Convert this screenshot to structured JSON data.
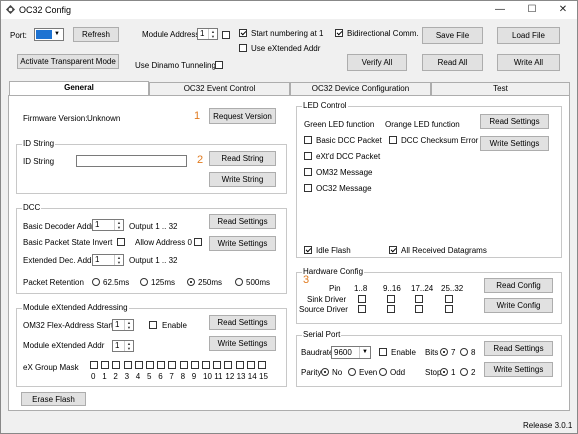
{
  "window": {
    "title": "OC32 Config",
    "minimize": "—",
    "maximize": "☐",
    "close": "✕"
  },
  "top": {
    "port_label": "Port:",
    "refresh": "Refresh",
    "module_address_label": "Module Address",
    "module_address_value": "1",
    "start_numbering": "Start numbering at 1",
    "use_extended": "Use eXtended Addr",
    "bidirectional": "Bidirectional Comm.",
    "save_file": "Save File",
    "load_file": "Load File",
    "activate_transparent": "Activate Transparent Mode",
    "use_dinamo": "Use Dinamo Tunneling",
    "verify_all": "Verify All",
    "read_all": "Read All",
    "write_all": "Write All"
  },
  "tabs": [
    "General",
    "OC32 Event Control",
    "OC32 Device Configuration",
    "Test"
  ],
  "general": {
    "firmware_label": "Firmware Version:",
    "firmware_value": "Unknown",
    "marker1": "1",
    "request_version": "Request Version",
    "id_group": "ID String",
    "id_label": "ID String",
    "marker2": "2",
    "read_string": "Read String",
    "write_string": "Write String",
    "dcc_group": "DCC",
    "basic_decoder_addr": "Basic Decoder Addr",
    "basic_decoder_value": "1",
    "output_range1": "Output 1 .. 32",
    "read_settings": "Read Settings",
    "write_settings": "Write Settings",
    "basic_packet_invert": "Basic Packet State Invert",
    "allow_address0": "Allow Address 0",
    "extended_dec_addr": "Extended Dec. Addr",
    "extended_dec_value": "1",
    "output_range2": "Output 1 .. 32",
    "packet_retention": "Packet Retention",
    "retention_options": [
      "62.5ms",
      "125ms",
      "250ms",
      "500ms"
    ],
    "mxa_group": "Module eXtended Addressing",
    "flex_start": "OM32 Flex-Address Start",
    "flex_value": "1",
    "enable": "Enable",
    "module_ext_addr": "Module eXtended Addr",
    "module_ext_value": "1",
    "group_mask": "eX Group Mask",
    "mask_numbers": [
      "0",
      "1",
      "2",
      "3",
      "4",
      "5",
      "6",
      "7",
      "8",
      "9",
      "10",
      "11",
      "12",
      "13",
      "14",
      "15"
    ],
    "erase_flash": "Erase Flash",
    "led_group": "LED Control",
    "green_led": "Green LED function",
    "orange_led": "Orange LED function",
    "basic_dcc_packet": "Basic DCC Packet",
    "dcc_checksum": "DCC Checksum Error",
    "extd_dcc_packet": "eXt'd DCC Packet",
    "om32_message1": "OM32 Message",
    "oc32_message": "OC32 Message",
    "idle_flash": "Idle Flash",
    "all_received": "All Received Datagrams",
    "hw_group": "Hardware Config",
    "marker3": "3",
    "pin_label": "Pin",
    "pin_ranges": [
      "1..8",
      "9..16",
      "17..24",
      "25..32"
    ],
    "sink_driver": "Sink Driver",
    "source_driver": "Source Driver",
    "read_config": "Read Config",
    "write_config": "Write Config",
    "serial_group": "Serial Port",
    "baudrate_label": "Baudrate",
    "baudrate_value": "9600",
    "bits_label": "Bits",
    "bits_options": [
      "7",
      "8"
    ],
    "parity_label": "Parity",
    "parity_options": [
      "No",
      "Even",
      "Odd"
    ],
    "stop_label": "Stop",
    "stop_options": [
      "1",
      "2"
    ]
  },
  "status": {
    "release": "Release 3.0.1"
  },
  "colors": {
    "port_swatch": "#1e73d2",
    "marker": "#e07a1e"
  }
}
